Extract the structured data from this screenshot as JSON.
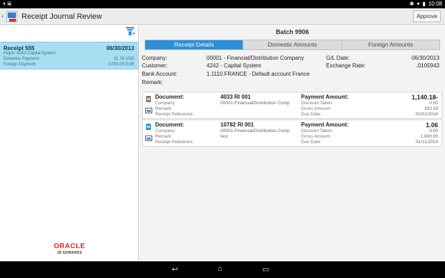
{
  "status_bar": {
    "left_icons": "⏴ ▣",
    "time": "10:08"
  },
  "header": {
    "title": "Receipt Journal Review",
    "approve_label": "Approve"
  },
  "list": {
    "items": [
      {
        "title": "Receipt 555",
        "date": "06/30/2013",
        "payor": "Payor: 4242-Capital System",
        "domestic_label": "Domestic Payment:",
        "domestic_value": "31.78 USD",
        "foreign_label": "Foreign Payment:",
        "foreign_value": "3,000.00 EUR"
      }
    ]
  },
  "branding": {
    "line1": "ORACLE",
    "line2": "JD EDWARDS"
  },
  "detail": {
    "batch": "Batch 9906",
    "tabs": [
      "Receipt Details",
      "Domestic Amounts",
      "Foreign Amounts"
    ],
    "active_tab": 0,
    "company_label": "Company:",
    "company_value": "00001 - Financial/Distribution Company",
    "customer_label": "Customer:",
    "customer_value": "4242 - Capital System",
    "bank_label": "Bank Account:",
    "bank_value": "1.1110.FRANCE - Default account France",
    "remark_label": "Remark:",
    "gl_label": "G/L Date:",
    "gl_value": "06/30/2013",
    "rate_label": "Exchange Rate:",
    "rate_value": ".0105943"
  },
  "doc_labels": {
    "document": "Document:",
    "company": "Company:",
    "remark": "Remark:",
    "receipt_ref": "Receipt Reference:",
    "payment_amount": "Payment Amount:",
    "discount_taken": "Discount Taken:",
    "gross_amount": "Gross Amount:",
    "due_date": "Due Date:"
  },
  "documents": [
    {
      "doc_no": "4033 RI 001",
      "company": "00001-Financial/Distribution Comp",
      "remark": "",
      "payment_amount": "1,140.18-",
      "discount_taken": "0.00",
      "gross_amount": "333.33",
      "due_date": "01/01/2014",
      "icon_color": "#777777"
    },
    {
      "doc_no": "10782 RI 001",
      "company": "00001-Financial/Distribution Comp",
      "remark": "test",
      "payment_amount": "1.06",
      "discount_taken": "0.00",
      "gross_amount": "1,900.00",
      "due_date": "01/11/2014",
      "icon_color": "#2B8FD9"
    }
  ],
  "colors": {
    "accent": "#2B8FD9",
    "selected_row": "#A7DEF2",
    "oracle_red": "#E3211B"
  }
}
